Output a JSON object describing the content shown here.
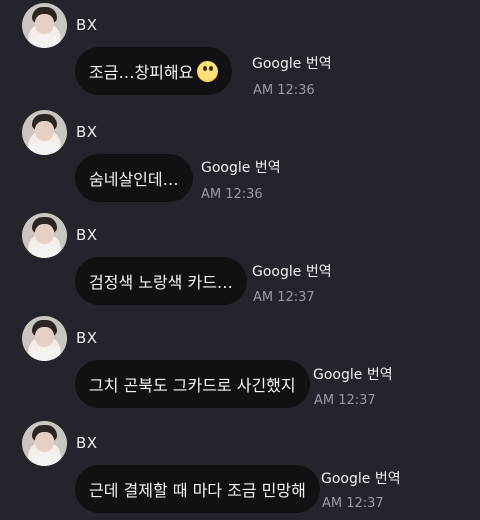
{
  "messages": [
    {
      "sender": "BX",
      "text": "조금…창피해요",
      "emoji": "face-with-rolling-eyes-emoji",
      "translate": "Google 번역",
      "time": "AM 12:36"
    },
    {
      "sender": "BX",
      "text": "숨네살인데…",
      "translate": "Google 번역",
      "time": "AM 12:36"
    },
    {
      "sender": "BX",
      "text": "검정색 노랑색 카드…",
      "translate": "Google 번역",
      "time": "AM 12:37"
    },
    {
      "sender": "BX",
      "text": "그치 곤북도 그카드로 사긴했지",
      "translate": "Google 번역",
      "time": "AM 12:37"
    },
    {
      "sender": "BX",
      "text": "근데 결제할 때 마다 조금 민망해",
      "translate": "Google 번역",
      "time": "AM 12:37"
    }
  ]
}
